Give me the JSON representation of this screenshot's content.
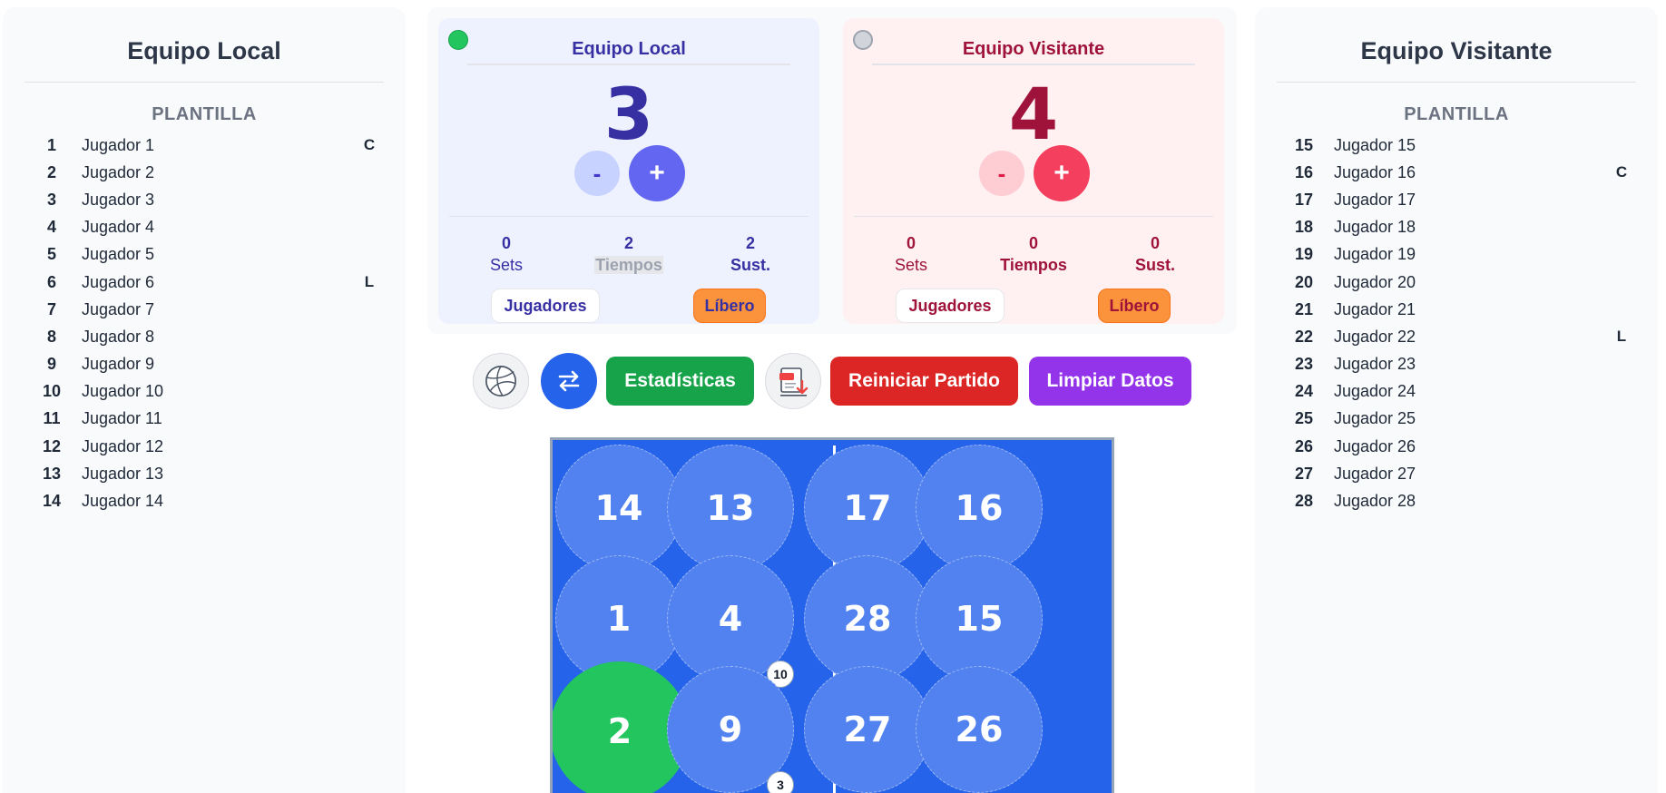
{
  "home_panel": {
    "title": "Equipo Local",
    "subtitle": "PLANTILLA",
    "players": [
      {
        "num": "1",
        "name": "Jugador 1",
        "tag": "C"
      },
      {
        "num": "2",
        "name": "Jugador 2",
        "tag": ""
      },
      {
        "num": "3",
        "name": "Jugador 3",
        "tag": ""
      },
      {
        "num": "4",
        "name": "Jugador 4",
        "tag": ""
      },
      {
        "num": "5",
        "name": "Jugador 5",
        "tag": ""
      },
      {
        "num": "6",
        "name": "Jugador 6",
        "tag": "L"
      },
      {
        "num": "7",
        "name": "Jugador 7",
        "tag": ""
      },
      {
        "num": "8",
        "name": "Jugador 8",
        "tag": ""
      },
      {
        "num": "9",
        "name": "Jugador 9",
        "tag": ""
      },
      {
        "num": "10",
        "name": "Jugador 10",
        "tag": ""
      },
      {
        "num": "11",
        "name": "Jugador 11",
        "tag": ""
      },
      {
        "num": "12",
        "name": "Jugador 12",
        "tag": ""
      },
      {
        "num": "13",
        "name": "Jugador 13",
        "tag": ""
      },
      {
        "num": "14",
        "name": "Jugador 14",
        "tag": ""
      }
    ]
  },
  "away_panel": {
    "title": "Equipo Visitante",
    "subtitle": "PLANTILLA",
    "players": [
      {
        "num": "15",
        "name": "Jugador 15",
        "tag": ""
      },
      {
        "num": "16",
        "name": "Jugador 16",
        "tag": "C"
      },
      {
        "num": "17",
        "name": "Jugador 17",
        "tag": ""
      },
      {
        "num": "18",
        "name": "Jugador 18",
        "tag": ""
      },
      {
        "num": "19",
        "name": "Jugador 19",
        "tag": ""
      },
      {
        "num": "20",
        "name": "Jugador 20",
        "tag": ""
      },
      {
        "num": "21",
        "name": "Jugador 21",
        "tag": ""
      },
      {
        "num": "22",
        "name": "Jugador 22",
        "tag": "L"
      },
      {
        "num": "23",
        "name": "Jugador 23",
        "tag": ""
      },
      {
        "num": "24",
        "name": "Jugador 24",
        "tag": ""
      },
      {
        "num": "25",
        "name": "Jugador 25",
        "tag": ""
      },
      {
        "num": "26",
        "name": "Jugador 26",
        "tag": ""
      },
      {
        "num": "27",
        "name": "Jugador 27",
        "tag": ""
      },
      {
        "num": "28",
        "name": "Jugador 28",
        "tag": ""
      }
    ]
  },
  "scoreboard": {
    "home": {
      "name": "Equipo Local",
      "score": "3",
      "serving": true,
      "minus_label": "-",
      "plus_label": "+",
      "sets_value": "0",
      "sets_label": "Sets",
      "timeouts_value": "2",
      "timeouts_label": "Tiempos",
      "subs_value": "2",
      "subs_label": "Sust.",
      "players_button": "Jugadores",
      "libero_button": "Líbero"
    },
    "away": {
      "name": "Equipo Visitante",
      "score": "4",
      "serving": false,
      "minus_label": "-",
      "plus_label": "+",
      "sets_value": "0",
      "sets_label": "Sets",
      "timeouts_value": "0",
      "timeouts_label": "Tiempos",
      "subs_value": "0",
      "subs_label": "Sust.",
      "players_button": "Jugadores",
      "libero_button": "Líbero"
    }
  },
  "toolbar": {
    "ball_icon": "volleyball-icon",
    "swap_icon": "swap-arrows-icon",
    "stats_label": "Estadísticas",
    "pdf_icon": "pdf-download-icon",
    "reset_label": "Reiniciar Partido",
    "clear_label": "Limpiar Datos"
  },
  "court": {
    "home_positions": [
      {
        "number": "14",
        "badge": ""
      },
      {
        "number": "13",
        "badge": ""
      },
      {
        "number": "1",
        "badge": ""
      },
      {
        "number": "4",
        "badge": "10"
      },
      {
        "number": "2",
        "badge": "",
        "active": true
      },
      {
        "number": "9",
        "badge": "3"
      }
    ],
    "away_positions": [
      {
        "number": "17"
      },
      {
        "number": "16"
      },
      {
        "number": "28"
      },
      {
        "number": "15"
      },
      {
        "number": "27"
      },
      {
        "number": "26"
      }
    ]
  },
  "colors": {
    "home_accent": "#3730a3",
    "away_accent": "#9f1239",
    "court": "#2563eb",
    "active_player": "#22c55e"
  }
}
